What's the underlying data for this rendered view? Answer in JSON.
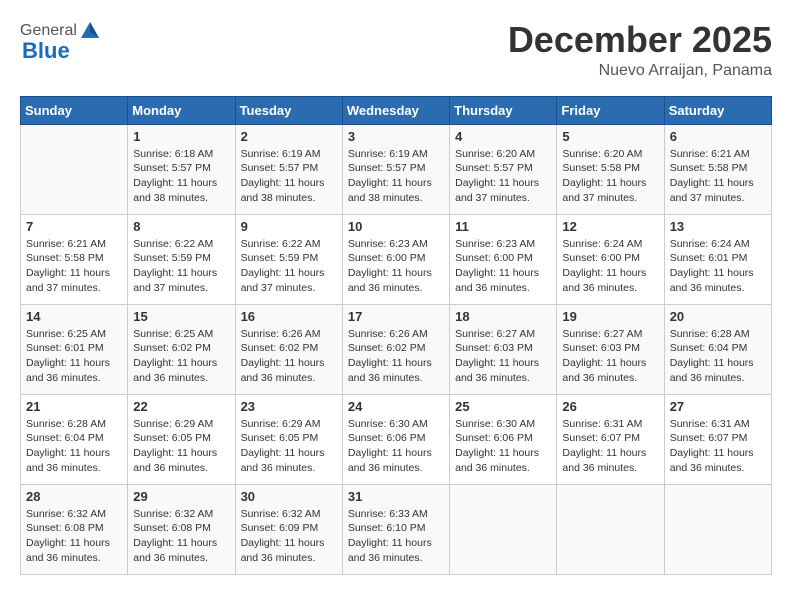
{
  "header": {
    "logo_general": "General",
    "logo_blue": "Blue",
    "month": "December 2025",
    "location": "Nuevo Arraijan, Panama"
  },
  "days_of_week": [
    "Sunday",
    "Monday",
    "Tuesday",
    "Wednesday",
    "Thursday",
    "Friday",
    "Saturday"
  ],
  "weeks": [
    [
      {
        "day": "",
        "info": ""
      },
      {
        "day": "1",
        "info": "Sunrise: 6:18 AM\nSunset: 5:57 PM\nDaylight: 11 hours and 38 minutes."
      },
      {
        "day": "2",
        "info": "Sunrise: 6:19 AM\nSunset: 5:57 PM\nDaylight: 11 hours and 38 minutes."
      },
      {
        "day": "3",
        "info": "Sunrise: 6:19 AM\nSunset: 5:57 PM\nDaylight: 11 hours and 38 minutes."
      },
      {
        "day": "4",
        "info": "Sunrise: 6:20 AM\nSunset: 5:57 PM\nDaylight: 11 hours and 37 minutes."
      },
      {
        "day": "5",
        "info": "Sunrise: 6:20 AM\nSunset: 5:58 PM\nDaylight: 11 hours and 37 minutes."
      },
      {
        "day": "6",
        "info": "Sunrise: 6:21 AM\nSunset: 5:58 PM\nDaylight: 11 hours and 37 minutes."
      }
    ],
    [
      {
        "day": "7",
        "info": "Sunrise: 6:21 AM\nSunset: 5:58 PM\nDaylight: 11 hours and 37 minutes."
      },
      {
        "day": "8",
        "info": "Sunrise: 6:22 AM\nSunset: 5:59 PM\nDaylight: 11 hours and 37 minutes."
      },
      {
        "day": "9",
        "info": "Sunrise: 6:22 AM\nSunset: 5:59 PM\nDaylight: 11 hours and 37 minutes."
      },
      {
        "day": "10",
        "info": "Sunrise: 6:23 AM\nSunset: 6:00 PM\nDaylight: 11 hours and 36 minutes."
      },
      {
        "day": "11",
        "info": "Sunrise: 6:23 AM\nSunset: 6:00 PM\nDaylight: 11 hours and 36 minutes."
      },
      {
        "day": "12",
        "info": "Sunrise: 6:24 AM\nSunset: 6:00 PM\nDaylight: 11 hours and 36 minutes."
      },
      {
        "day": "13",
        "info": "Sunrise: 6:24 AM\nSunset: 6:01 PM\nDaylight: 11 hours and 36 minutes."
      }
    ],
    [
      {
        "day": "14",
        "info": "Sunrise: 6:25 AM\nSunset: 6:01 PM\nDaylight: 11 hours and 36 minutes."
      },
      {
        "day": "15",
        "info": "Sunrise: 6:25 AM\nSunset: 6:02 PM\nDaylight: 11 hours and 36 minutes."
      },
      {
        "day": "16",
        "info": "Sunrise: 6:26 AM\nSunset: 6:02 PM\nDaylight: 11 hours and 36 minutes."
      },
      {
        "day": "17",
        "info": "Sunrise: 6:26 AM\nSunset: 6:02 PM\nDaylight: 11 hours and 36 minutes."
      },
      {
        "day": "18",
        "info": "Sunrise: 6:27 AM\nSunset: 6:03 PM\nDaylight: 11 hours and 36 minutes."
      },
      {
        "day": "19",
        "info": "Sunrise: 6:27 AM\nSunset: 6:03 PM\nDaylight: 11 hours and 36 minutes."
      },
      {
        "day": "20",
        "info": "Sunrise: 6:28 AM\nSunset: 6:04 PM\nDaylight: 11 hours and 36 minutes."
      }
    ],
    [
      {
        "day": "21",
        "info": "Sunrise: 6:28 AM\nSunset: 6:04 PM\nDaylight: 11 hours and 36 minutes."
      },
      {
        "day": "22",
        "info": "Sunrise: 6:29 AM\nSunset: 6:05 PM\nDaylight: 11 hours and 36 minutes."
      },
      {
        "day": "23",
        "info": "Sunrise: 6:29 AM\nSunset: 6:05 PM\nDaylight: 11 hours and 36 minutes."
      },
      {
        "day": "24",
        "info": "Sunrise: 6:30 AM\nSunset: 6:06 PM\nDaylight: 11 hours and 36 minutes."
      },
      {
        "day": "25",
        "info": "Sunrise: 6:30 AM\nSunset: 6:06 PM\nDaylight: 11 hours and 36 minutes."
      },
      {
        "day": "26",
        "info": "Sunrise: 6:31 AM\nSunset: 6:07 PM\nDaylight: 11 hours and 36 minutes."
      },
      {
        "day": "27",
        "info": "Sunrise: 6:31 AM\nSunset: 6:07 PM\nDaylight: 11 hours and 36 minutes."
      }
    ],
    [
      {
        "day": "28",
        "info": "Sunrise: 6:32 AM\nSunset: 6:08 PM\nDaylight: 11 hours and 36 minutes."
      },
      {
        "day": "29",
        "info": "Sunrise: 6:32 AM\nSunset: 6:08 PM\nDaylight: 11 hours and 36 minutes."
      },
      {
        "day": "30",
        "info": "Sunrise: 6:32 AM\nSunset: 6:09 PM\nDaylight: 11 hours and 36 minutes."
      },
      {
        "day": "31",
        "info": "Sunrise: 6:33 AM\nSunset: 6:10 PM\nDaylight: 11 hours and 36 minutes."
      },
      {
        "day": "",
        "info": ""
      },
      {
        "day": "",
        "info": ""
      },
      {
        "day": "",
        "info": ""
      }
    ]
  ]
}
